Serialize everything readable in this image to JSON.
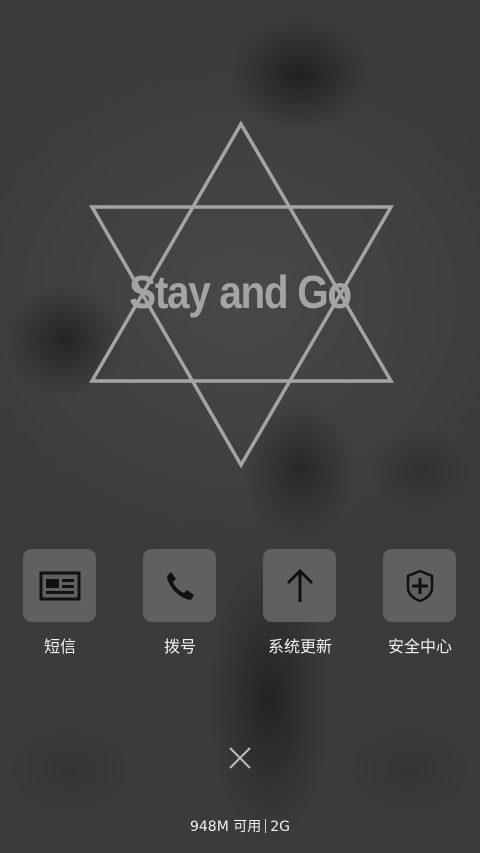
{
  "wallpaper": {
    "logo_text": "Stay and Go",
    "logo_color": "#a4a4a4"
  },
  "quick_actions": [
    {
      "label": "短信",
      "icon": "message-icon"
    },
    {
      "label": "拨号",
      "icon": "phone-icon"
    },
    {
      "label": "系统更新",
      "icon": "arrow-up-icon"
    },
    {
      "label": "安全中心",
      "icon": "shield-plus-icon"
    }
  ],
  "close": {
    "icon": "close-icon"
  },
  "status": {
    "memory": "948M 可用",
    "network": "2G"
  }
}
